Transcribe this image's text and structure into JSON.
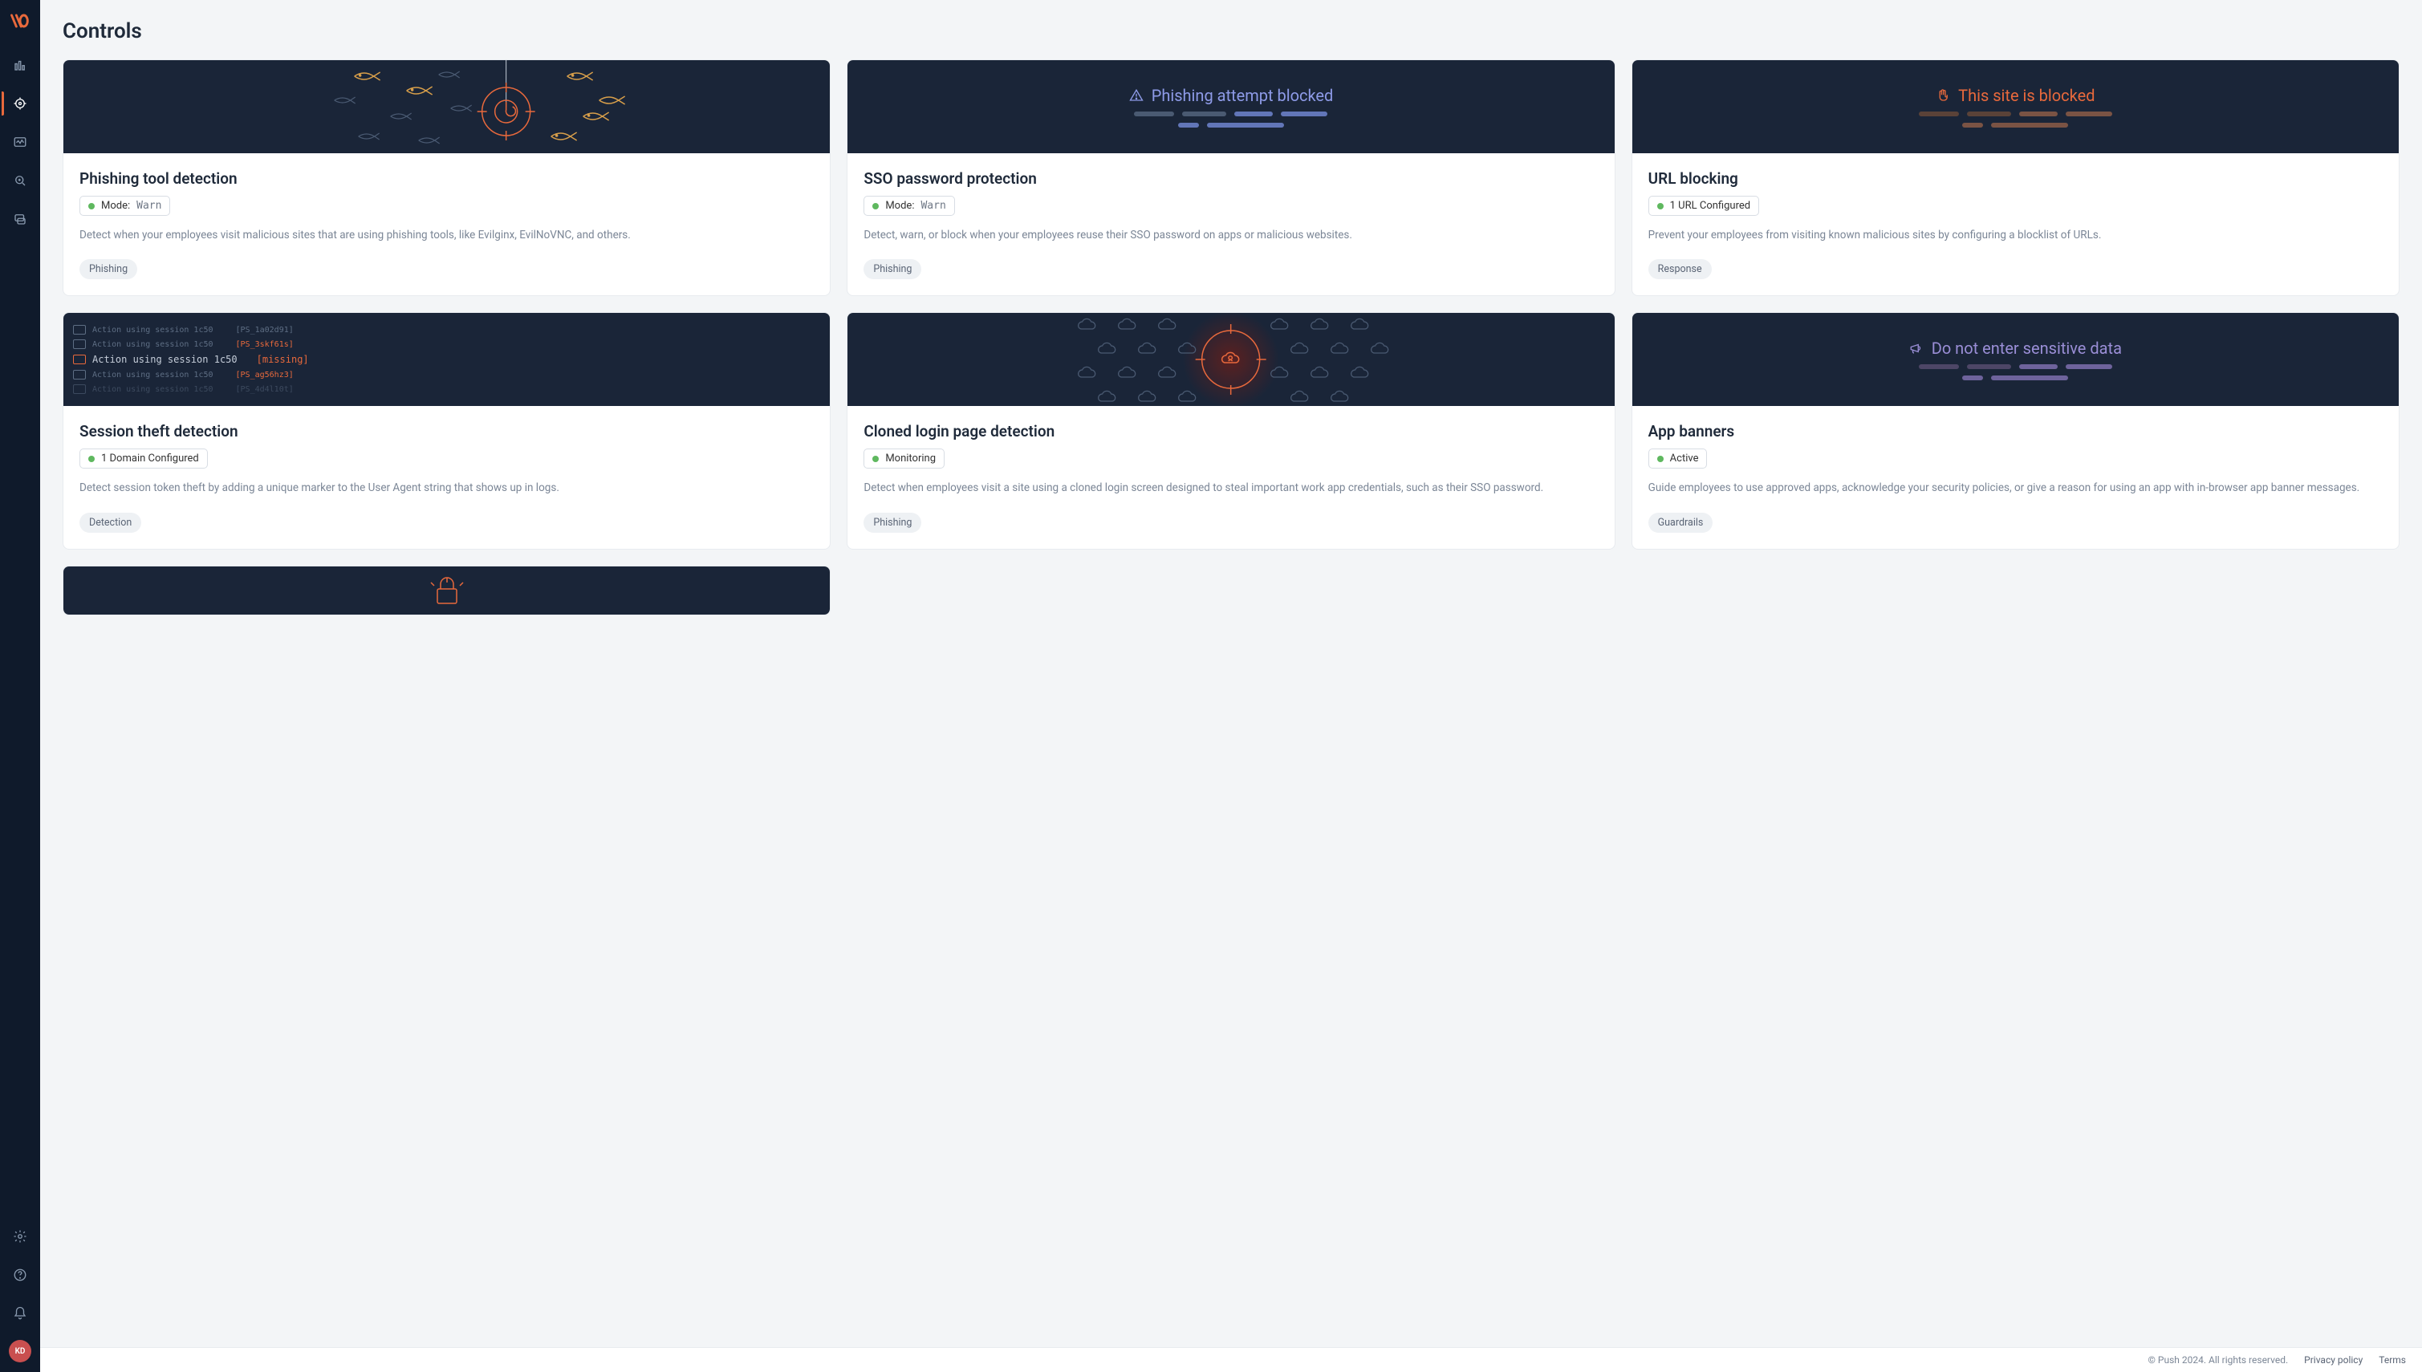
{
  "sidebar": {
    "avatar_initials": "KD"
  },
  "page": {
    "title": "Controls"
  },
  "cards": [
    {
      "title": "Phishing tool detection",
      "status_prefix": "Mode:",
      "status_value": "Warn",
      "description": "Detect when your employees visit malicious sites that are using phishing tools, like Evilginx, EvilNoVNC, and others.",
      "tag": "Phishing"
    },
    {
      "title": "SSO password protection",
      "hero_text": "Phishing attempt blocked",
      "status_prefix": "Mode:",
      "status_value": "Warn",
      "description": "Detect, warn, or block when your employees reuse their SSO password on apps or malicious websites.",
      "tag": "Phishing"
    },
    {
      "title": "URL blocking",
      "hero_text": "This site is blocked",
      "status_text": "1 URL Configured",
      "description": "Prevent your employees from visiting known malicious sites by configuring a blocklist of URLs.",
      "tag": "Response"
    },
    {
      "title": "Session theft detection",
      "status_text": "1 Domain Configured",
      "description": "Detect session token theft by adding a unique marker to the User Agent string that shows up in logs.",
      "tag": "Detection",
      "sess_lines": [
        {
          "text": "Action using session 1c50",
          "tag": "[PS_1a02d91]"
        },
        {
          "text": "Action using session 1c50",
          "tag": "[PS_3skf61s]"
        },
        {
          "text": "Action using session 1c50",
          "tag": "[missing]",
          "big": true
        },
        {
          "text": "Action using session 1c50",
          "tag": "[PS_ag56hz3]"
        },
        {
          "text": "Action using session 1c50",
          "tag": "[PS_4d4l10t]"
        }
      ]
    },
    {
      "title": "Cloned login page detection",
      "status_text": "Monitoring",
      "description": "Detect when employees visit a site using a cloned login screen designed to steal important work app credentials, such as their SSO password.",
      "tag": "Phishing"
    },
    {
      "title": "App banners",
      "hero_text": "Do not enter sensitive data",
      "status_text": "Active",
      "description": "Guide employees to use approved apps, acknowledge your security policies, or give a reason for using an app with in-browser app banner messages.",
      "tag": "Guardrails"
    }
  ],
  "footer": {
    "copyright": "© Push 2024. All rights reserved.",
    "privacy": "Privacy policy",
    "terms": "Terms"
  }
}
